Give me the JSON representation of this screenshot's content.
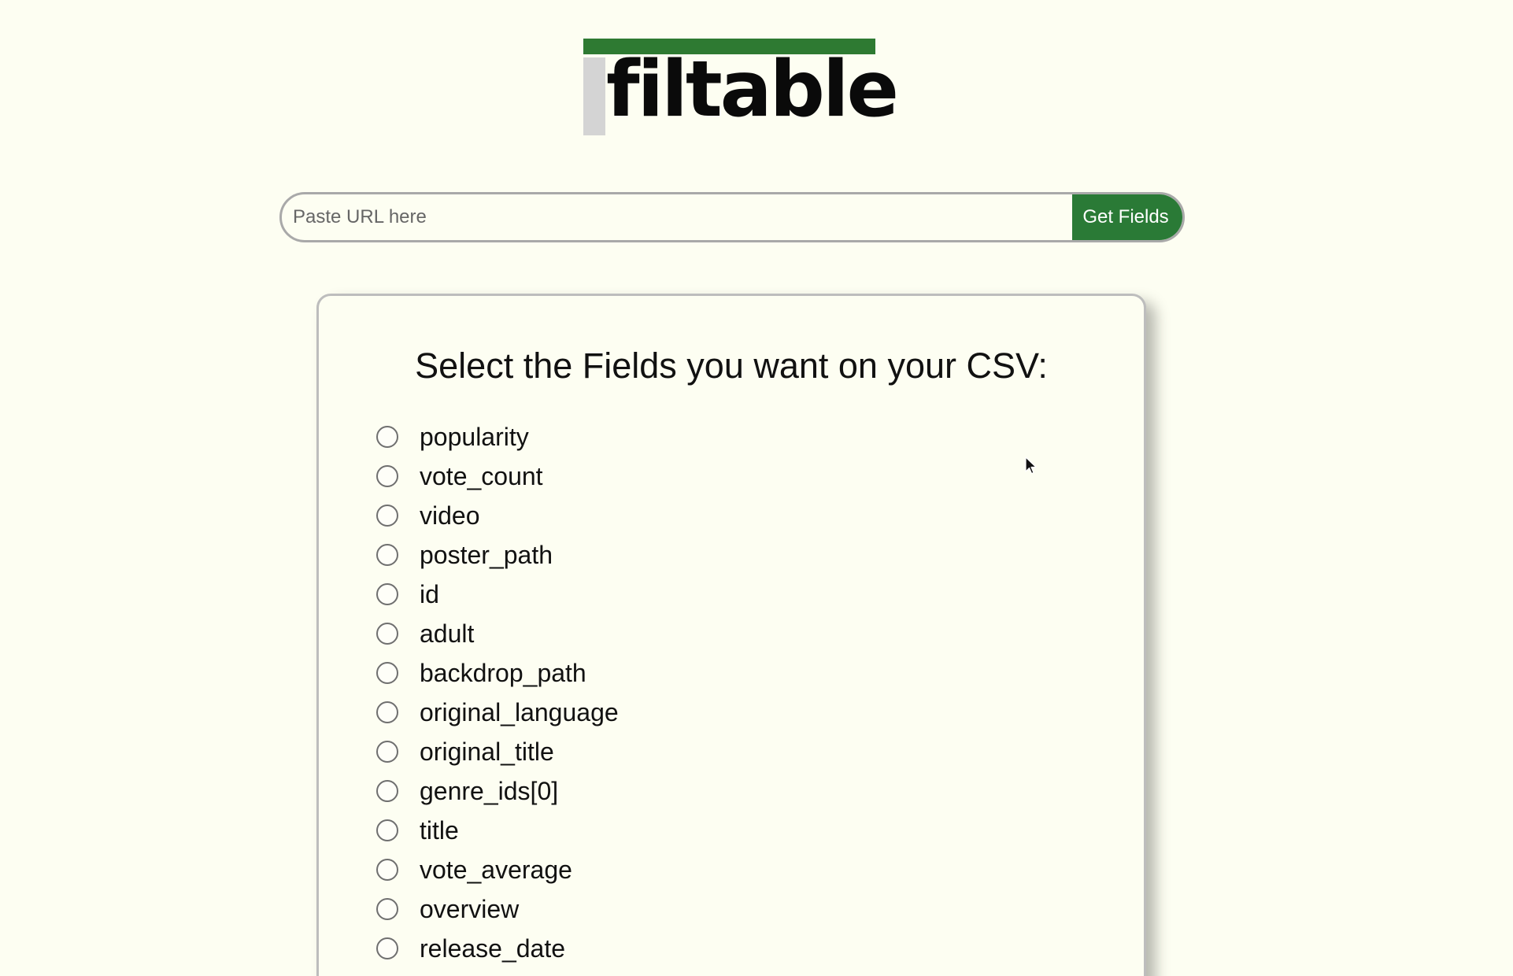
{
  "logo": {
    "text": "filtable"
  },
  "url_bar": {
    "placeholder": "Paste URL here",
    "value": "",
    "button_label": "Get Fields"
  },
  "card": {
    "title": "Select the Fields you want on your CSV:",
    "fields": [
      "popularity",
      "vote_count",
      "video",
      "poster_path",
      "id",
      "adult",
      "backdrop_path",
      "original_language",
      "original_title",
      "genre_ids[0]",
      "title",
      "vote_average",
      "overview",
      "release_date"
    ]
  },
  "colors": {
    "background": "#fdfef2",
    "accent": "#2a7a36",
    "logo_bar": "#2e7a32",
    "logo_stub": "#d4d4d4",
    "border": "#a9a9a9"
  },
  "icons": {
    "cursor": "mouse-pointer-icon",
    "radio": "radio-unchecked-icon"
  }
}
